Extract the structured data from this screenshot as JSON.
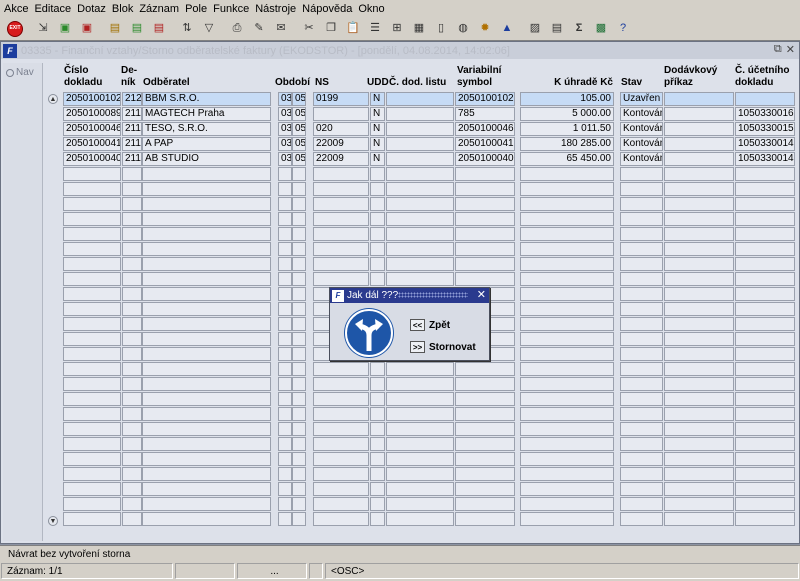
{
  "menu": [
    "Akce",
    "Editace",
    "Dotaz",
    "Blok",
    "Záznam",
    "Pole",
    "Funkce",
    "Nástroje",
    "Nápověda",
    "Okno"
  ],
  "toolbar": {
    "exit_label": "EXIT",
    "icons": [
      "exit-icon",
      "save-icon",
      "new-record-icon",
      "delete-record-icon",
      "query-icon",
      "execute-query-icon",
      "cancel-query-icon",
      "sort-icon",
      "filter-icon",
      "print-icon",
      "attach-icon",
      "mail-icon",
      "cut-icon",
      "copy-icon",
      "paste-icon",
      "list-icon",
      "insert-icon",
      "calculator-icon",
      "document-icon",
      "globe-icon",
      "sun-icon",
      "triangle-icon",
      "report-icon",
      "table-icon",
      "sigma-icon",
      "excel-icon",
      "help-icon"
    ]
  },
  "window": {
    "title": "03335 - Finanční vztahy/Storno odběratelské faktury (EKODSTOR) - [pondělí, 04.08.2014, 14:02:06]",
    "nav_label": "Nav"
  },
  "columns": {
    "cislo": "Číslo dokladu",
    "denik": "De-ník",
    "odberatel": "Odběratel",
    "obdobi": "Období",
    "ns": "NS",
    "udd": "UDD",
    "dod_list": "Č. dod. listu",
    "var_symbol": "Variabilní symbol",
    "k_uhrade": "K úhradě Kč",
    "stav": "Stav",
    "dodavkovy": "Dodávkový příkaz",
    "ucetni": "Č. účetního dokladu"
  },
  "rows": [
    {
      "cislo": "2050100102",
      "denik": "212",
      "odberatel": "BBM S.R.O.",
      "obd1": "03",
      "obd2": "05",
      "ns": "0199",
      "udd": "N",
      "dod": "",
      "vs": "2050100102",
      "kc": "105.00",
      "stav": "Uzavřen",
      "prikaz": "",
      "ucet": ""
    },
    {
      "cislo": "2050100089",
      "denik": "211",
      "odberatel": "MAGTECH Praha",
      "obd1": "03",
      "obd2": "05",
      "ns": "",
      "udd": "N",
      "dod": "",
      "vs": "785",
      "kc": "5 000.00",
      "stav": "Kontován",
      "prikaz": "",
      "ucet": "1050330016"
    },
    {
      "cislo": "2050100046",
      "denik": "211",
      "odberatel": "TESO, S.R.O.",
      "obd1": "03",
      "obd2": "05",
      "ns": "020",
      "udd": "N",
      "dod": "",
      "vs": "2050100046",
      "kc": "1 011.50",
      "stav": "Kontován",
      "prikaz": "",
      "ucet": "1050330015"
    },
    {
      "cislo": "2050100041",
      "denik": "211",
      "odberatel": "A PAP",
      "obd1": "03",
      "obd2": "05",
      "ns": "22009",
      "udd": "N",
      "dod": "",
      "vs": "2050100041",
      "kc": "180 285.00",
      "stav": "Kontován",
      "prikaz": "",
      "ucet": "1050330014"
    },
    {
      "cislo": "2050100040",
      "denik": "211",
      "odberatel": "AB STUDIO",
      "obd1": "03",
      "obd2": "05",
      "ns": "22009",
      "udd": "N",
      "dod": "",
      "vs": "2050100040",
      "kc": "65 450.00",
      "stav": "Kontován",
      "prikaz": "",
      "ucet": "1050330014"
    }
  ],
  "dialog": {
    "title": "Jak dál ???",
    "back_btn": "<<",
    "back_label": "Zpět",
    "cancel_btn": ">>",
    "cancel_label": "Stornovat"
  },
  "status": {
    "message": "Návrat bez vytvoření storna",
    "record": "Záznam: 1/1",
    "seg2": "",
    "seg3": "...",
    "seg4": "",
    "mode": "<OSC>"
  }
}
